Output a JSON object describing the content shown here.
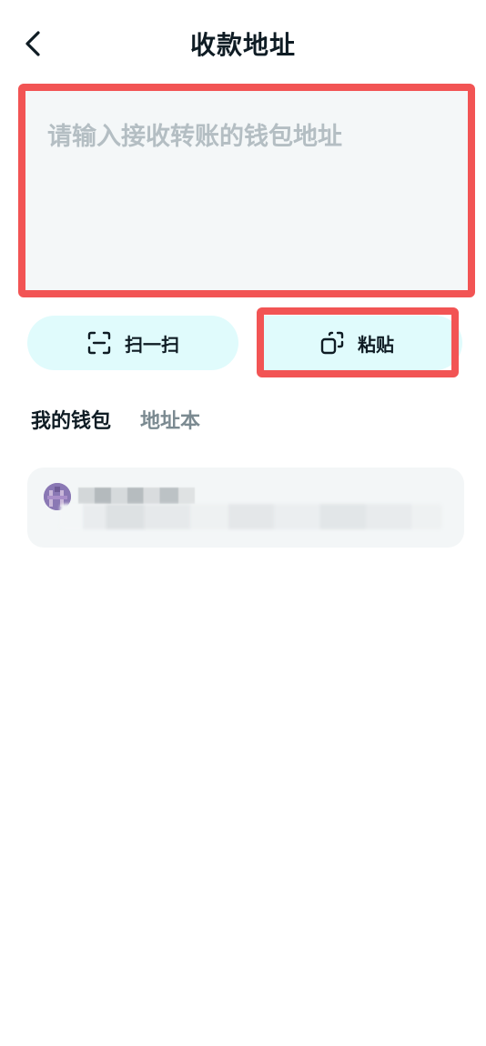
{
  "header": {
    "title": "收款地址",
    "back_icon": "chevron-left-icon"
  },
  "address_input": {
    "placeholder": "请输入接收转账的钱包地址",
    "value": ""
  },
  "actions": {
    "scan": {
      "label": "扫一扫",
      "icon": "scan-icon"
    },
    "paste": {
      "label": "粘贴",
      "icon": "paste-icon"
    }
  },
  "tabs": [
    {
      "label": "我的钱包",
      "active": true
    },
    {
      "label": "地址本",
      "active": false
    }
  ],
  "wallets": [
    {
      "name": "",
      "address": "",
      "avatar_icon": "wallet-avatar-icon"
    }
  ],
  "colors": {
    "highlight_border": "#f25454",
    "button_bg": "#e0fbfc",
    "input_bg": "#f4f7f8",
    "card_bg": "#f3f6f7",
    "text_primary": "#0f1c24",
    "text_muted": "#7b8a91",
    "placeholder": "#b4bec3",
    "avatar": "#8a78b4"
  }
}
